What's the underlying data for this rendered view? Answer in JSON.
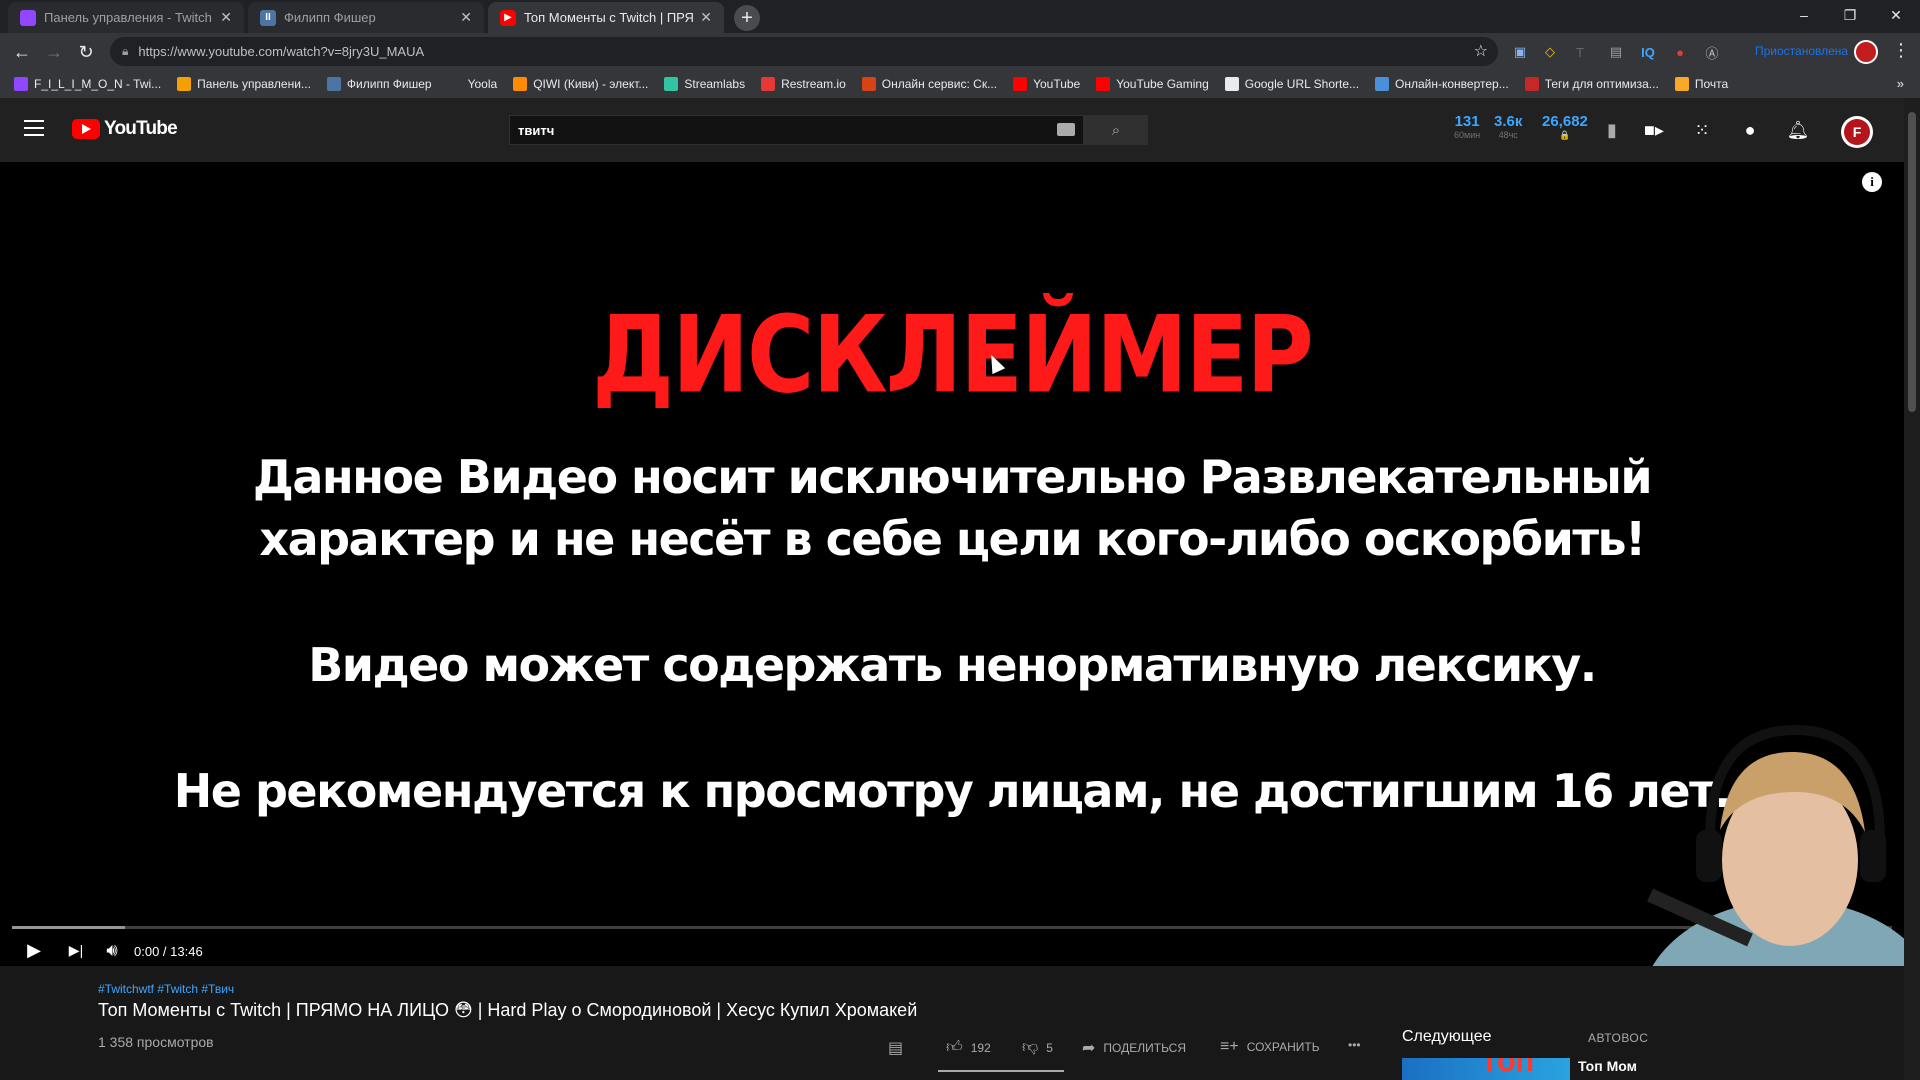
{
  "browser": {
    "tabs": [
      {
        "title": "Панель управления - Twitch",
        "favicon_color": "#9146ff",
        "active": false
      },
      {
        "title": "Филипп Фишер",
        "favicon_color": "#4c75a3",
        "active": false
      },
      {
        "title": "Топ Моменты с Twitch | ПРЯМО",
        "favicon_color": "#ff0000",
        "active": true
      }
    ],
    "new_tab_icon": "+",
    "window_controls": {
      "minimize": "–",
      "restore": "❐",
      "close": "✕"
    },
    "url": "https://www.youtube.com/watch?v=8jry3U_MAUA",
    "ext_label": "Приостановлена",
    "bookmarks": [
      {
        "label": "F_I_L_I_M_O_N - Twi...",
        "color": "#9146ff"
      },
      {
        "label": "Панель управлени...",
        "color": "#f2a100"
      },
      {
        "label": "Филипп Фишер",
        "color": "#4c75a3"
      },
      {
        "label": "Yoola",
        "color": "#35363a"
      },
      {
        "label": "QIWI (Киви) - элект...",
        "color": "#ff8c00"
      },
      {
        "label": "Streamlabs",
        "color": "#31c3a2"
      },
      {
        "label": "Restream.io",
        "color": "#e53935"
      },
      {
        "label": "Онлайн сервис: Ск...",
        "color": "#d84315"
      },
      {
        "label": "YouTube",
        "color": "#ff0000"
      },
      {
        "label": "YouTube Gaming",
        "color": "#ff0000"
      },
      {
        "label": "Google URL Shorte...",
        "color": "#e8eaed"
      },
      {
        "label": "Онлайн-конвертер...",
        "color": "#4a90d9"
      },
      {
        "label": "Теги для оптимиза...",
        "color": "#c62828"
      },
      {
        "label": "Почта",
        "color": "#f9a825"
      }
    ],
    "bookmarks_more": "»"
  },
  "masthead": {
    "logo_text": "YouTube",
    "search_query": "твитч",
    "stats": [
      {
        "value": "131",
        "sub": "60мин"
      },
      {
        "value": "3.6к",
        "sub": "48чс"
      },
      {
        "value": "26,682",
        "sub": "🔒"
      }
    ],
    "avatar_letter": "F"
  },
  "player": {
    "disclaimer_title": "ДИСКЛЕЙМЕР",
    "line1": "Данное Видео носит исключительно Развлекательный",
    "line2": "характер и не несёт в себе цели кого-либо оскорбить!",
    "line3": "Видео может содержать ненормативную лексику.",
    "line4": "Не рекомендуется к просмотру лицам, не достигшим 16 лет.",
    "time_display": "0:00 / 13:46",
    "progress_fraction": 0.0,
    "buffered_fraction": 0.06
  },
  "video": {
    "tags": "#Twitchwtf #Twitch #Твич",
    "title": "Топ Моменты с Twitch | ПРЯМО НА ЛИЦО 😳 | Hard Play о Смородиновой | Хесус Купил Хромакей",
    "views": "1 358 просмотров",
    "likes": "192",
    "dislikes": "5",
    "share_label": "ПОДЕЛИТЬСЯ",
    "save_label": "СОХРАНИТЬ",
    "more_label": "•••"
  },
  "sidebar": {
    "next_label": "Следующее",
    "autoplay_label": "АВТОВОС",
    "next_thumb_text": "ТОП",
    "next_title": "Топ Мом"
  }
}
